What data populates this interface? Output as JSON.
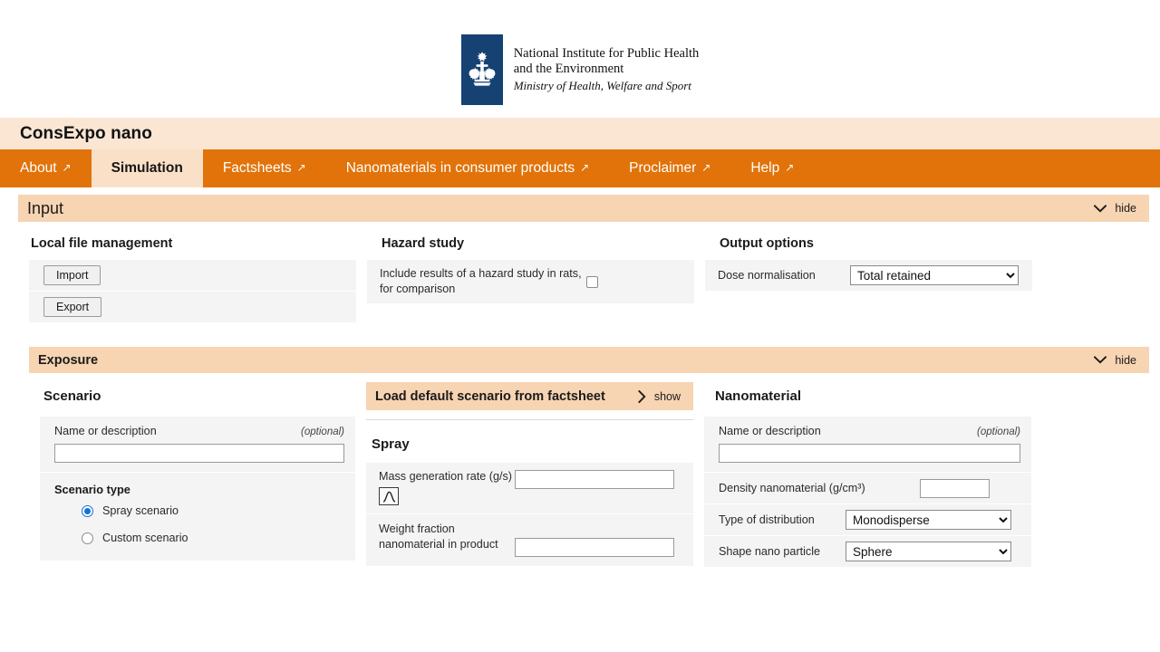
{
  "logo": {
    "line1": "National Institute for Public Health",
    "line2": "and the Environment",
    "ministry": "Ministry of Health, Welfare and Sport"
  },
  "header": {
    "app_title": "ConsExpo nano"
  },
  "nav": {
    "items": [
      {
        "label": "About",
        "external": true,
        "active": false
      },
      {
        "label": "Simulation",
        "external": false,
        "active": true
      },
      {
        "label": "Factsheets",
        "external": true,
        "active": false
      },
      {
        "label": "Nanomaterials in consumer products",
        "external": true,
        "active": false
      },
      {
        "label": "Proclaimer",
        "external": true,
        "active": false
      },
      {
        "label": "Help",
        "external": true,
        "active": false
      }
    ],
    "external_glyph": "↗"
  },
  "colors": {
    "nav_orange": "#e1730a",
    "title_bar": "#fbe6d4",
    "section_bar": "#f7d4b2",
    "logo_blue": "#154273",
    "row_grey": "#f4f4f4",
    "radio_accent": "#1273d4"
  },
  "input_section": {
    "title": "Input",
    "toggle_label": "hide",
    "local_file": {
      "heading": "Local file management",
      "import_label": "Import",
      "export_label": "Export"
    },
    "hazard_study": {
      "heading": "Hazard study",
      "checkbox_label": "Include results of a hazard study in rats, for comparison",
      "checked": false
    },
    "output_options": {
      "heading": "Output options",
      "dose_normalisation_label": "Dose normalisation",
      "dose_normalisation_value": "Total retained",
      "dose_normalisation_options": [
        "Total retained"
      ]
    }
  },
  "exposure_section": {
    "title": "Exposure",
    "toggle_label": "hide",
    "scenario": {
      "heading": "Scenario",
      "name_label": "Name or description",
      "name_optional": "(optional)",
      "name_value": "",
      "type_label": "Scenario type",
      "options": [
        {
          "label": "Spray scenario",
          "selected": true
        },
        {
          "label": "Custom scenario",
          "selected": false
        }
      ]
    },
    "load_default": {
      "title": "Load default scenario from factsheet",
      "toggle_label": "show"
    },
    "spray": {
      "heading": "Spray",
      "fields": [
        {
          "label": "Mass generation rate (g/s)",
          "value": "",
          "has_distribution_icon": true
        },
        {
          "label": "Weight fraction nanomaterial in product",
          "value": "",
          "has_distribution_icon": false
        }
      ]
    },
    "nanomaterial": {
      "heading": "Nanomaterial",
      "name_label": "Name or description",
      "name_optional": "(optional)",
      "name_value": "",
      "density_label": "Density nanomaterial (g/cm³)",
      "density_value": "",
      "distribution_label": "Type of distribution",
      "distribution_value": "Monodisperse",
      "distribution_options": [
        "Monodisperse"
      ],
      "shape_label": "Shape nano particle",
      "shape_value": "Sphere",
      "shape_options": [
        "Sphere"
      ]
    }
  }
}
